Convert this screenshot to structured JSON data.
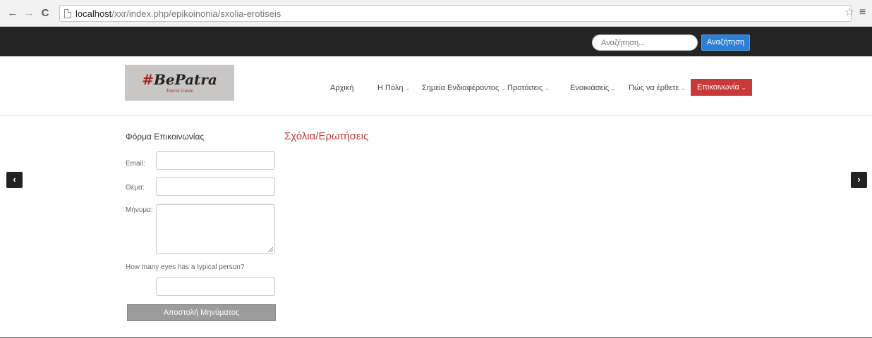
{
  "browser": {
    "back_icon": "arrow-left-icon",
    "forward_icon": "arrow-right-icon",
    "reload_icon": "reload-icon",
    "url_host": "localhost",
    "url_path": "/xxr/index.php/epikoinonia/sxolia-erotiseis"
  },
  "search": {
    "placeholder": "Αναζήτηση...",
    "button_label": "Αναζήτηση"
  },
  "logo": {
    "hash": "#",
    "name": "BePatra",
    "tagline": "Tourist Guide"
  },
  "nav": {
    "items": [
      {
        "label": "Αρχική",
        "dropdown": false
      },
      {
        "label": "Η Πόλη",
        "dropdown": true
      },
      {
        "label": "Σημεία Ενδιαφέροντος",
        "dropdown": true
      },
      {
        "label": "Προτάσεις",
        "dropdown": true
      },
      {
        "label": "Ενοικιάσεις",
        "dropdown": true
      },
      {
        "label": "Πώς να έρθετε",
        "dropdown": true
      },
      {
        "label": "Επικοινωνία",
        "dropdown": true,
        "active": true
      }
    ],
    "chevron": "⌄"
  },
  "colors": {
    "accent_red": "#c9393a",
    "search_blue": "#2a7fd6",
    "top_bar": "#242424"
  },
  "contact_form": {
    "title": "Φόρμα Επικοινωνίας",
    "email_label": "Email:",
    "email_value": "",
    "subject_label": "Θέμα:",
    "subject_value": "",
    "message_label": "Μήνυμα:",
    "message_value": "",
    "captcha_question": "How many eyes has a typical person?",
    "captcha_value": "",
    "submit_label": "Αποστολή Μηνύματος"
  },
  "content": {
    "title": "Σχόλια/Ερωτήσεις"
  },
  "carousel": {
    "prev": "‹",
    "next": "›"
  }
}
